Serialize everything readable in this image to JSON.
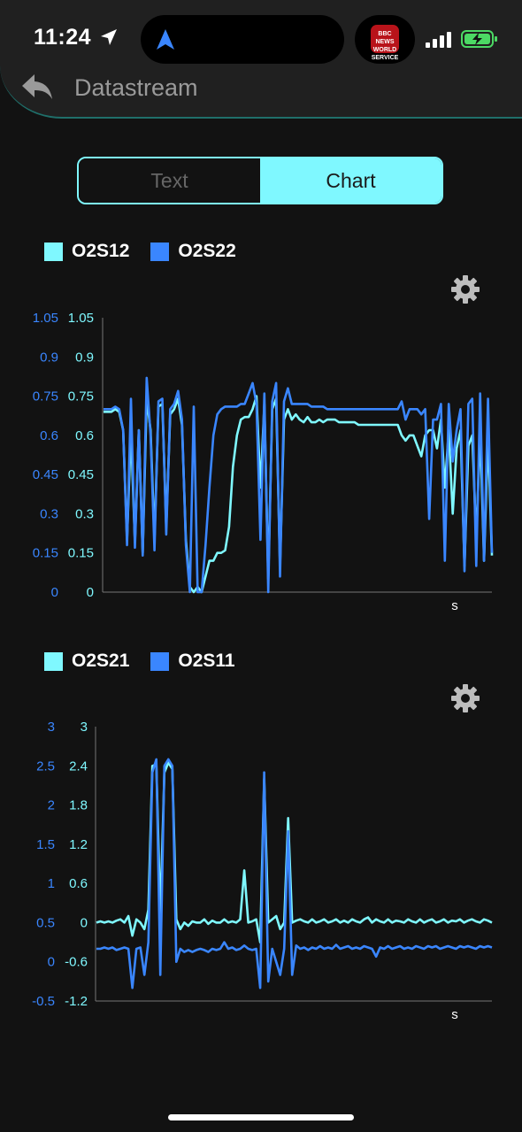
{
  "status_bar": {
    "time": "11:24",
    "news_app": "BBC NEWS WORLD SERVICE"
  },
  "header": {
    "title": "Datastream"
  },
  "tabs": [
    {
      "label": "Text",
      "active": false
    },
    {
      "label": "Chart",
      "active": true
    }
  ],
  "colors": {
    "cyan": "#7ff8ff",
    "blue": "#3a86ff",
    "background": "#121212"
  },
  "icons": [
    "back-arrow-icon",
    "gear-icon",
    "location-arrow-icon"
  ],
  "chart_data": [
    {
      "type": "line",
      "legend": [
        "O2S12",
        "O2S22"
      ],
      "left_axis_ticks": [
        "1.05",
        "0.9",
        "0.75",
        "0.6",
        "0.45",
        "0.3",
        "0.15",
        "0"
      ],
      "right_axis_ticks": [
        "1.05",
        "0.9",
        "0.75",
        "0.6",
        "0.45",
        "0.3",
        "0.15",
        "0"
      ],
      "x_unit": "s",
      "ylim": [
        0,
        1.05
      ],
      "series": [
        {
          "name": "O2S12",
          "color": "#7ff8ff",
          "values": [
            0.69,
            0.69,
            0.69,
            0.7,
            0.69,
            0.62,
            0.2,
            0.62,
            0.19,
            0.62,
            0.15,
            0.74,
            0.62,
            0.2,
            0.71,
            0.72,
            0.25,
            0.68,
            0.7,
            0.74,
            0.64,
            0.2,
            0.02,
            0.0,
            0.02,
            0.0,
            0.06,
            0.12,
            0.12,
            0.15,
            0.15,
            0.16,
            0.25,
            0.48,
            0.6,
            0.66,
            0.67,
            0.67,
            0.7,
            0.75,
            0.4,
            0.72,
            0.05,
            0.7,
            0.74,
            0.1,
            0.66,
            0.7,
            0.66,
            0.68,
            0.66,
            0.65,
            0.67,
            0.65,
            0.65,
            0.66,
            0.65,
            0.66,
            0.66,
            0.66,
            0.65,
            0.65,
            0.65,
            0.65,
            0.65,
            0.64,
            0.64,
            0.64,
            0.64,
            0.64,
            0.64,
            0.64,
            0.64,
            0.64,
            0.64,
            0.64,
            0.6,
            0.58,
            0.6,
            0.6,
            0.56,
            0.52,
            0.6,
            0.62,
            0.62,
            0.55,
            0.66,
            0.4,
            0.62,
            0.3,
            0.55,
            0.62,
            0.1,
            0.56,
            0.6,
            0.2,
            0.62,
            0.12,
            0.6,
            0.14
          ]
        },
        {
          "name": "O2S22",
          "color": "#3a86ff",
          "values": [
            0.7,
            0.7,
            0.7,
            0.71,
            0.7,
            0.62,
            0.18,
            0.74,
            0.17,
            0.62,
            0.14,
            0.82,
            0.6,
            0.16,
            0.73,
            0.74,
            0.22,
            0.7,
            0.72,
            0.77,
            0.66,
            0.18,
            0.0,
            0.71,
            0.0,
            0.0,
            0.18,
            0.4,
            0.6,
            0.68,
            0.7,
            0.71,
            0.71,
            0.71,
            0.71,
            0.72,
            0.72,
            0.76,
            0.8,
            0.72,
            0.2,
            0.76,
            0.0,
            0.73,
            0.8,
            0.06,
            0.73,
            0.78,
            0.72,
            0.72,
            0.72,
            0.72,
            0.72,
            0.71,
            0.71,
            0.71,
            0.71,
            0.7,
            0.7,
            0.7,
            0.7,
            0.7,
            0.7,
            0.7,
            0.7,
            0.7,
            0.7,
            0.7,
            0.7,
            0.7,
            0.7,
            0.7,
            0.7,
            0.7,
            0.7,
            0.7,
            0.73,
            0.66,
            0.7,
            0.7,
            0.7,
            0.68,
            0.7,
            0.28,
            0.66,
            0.66,
            0.72,
            0.12,
            0.72,
            0.5,
            0.62,
            0.7,
            0.08,
            0.72,
            0.74,
            0.1,
            0.76,
            0.12,
            0.74,
            0.15
          ]
        }
      ]
    },
    {
      "type": "line",
      "legend": [
        "O2S21",
        "O2S11"
      ],
      "left_axis_ticks": [
        "3",
        "2.5",
        "2",
        "1.5",
        "1",
        "0.5",
        "0",
        "-0.5"
      ],
      "right_axis_ticks": [
        "3",
        "2.4",
        "1.8",
        "1.2",
        "0.6",
        "0",
        "-0.6",
        "-1.2"
      ],
      "x_unit": "s",
      "ylim": [
        -1.2,
        3
      ],
      "series": [
        {
          "name": "O2S21",
          "color": "#7ff8ff",
          "values": [
            0.0,
            0.02,
            0.0,
            0.02,
            0.0,
            0.03,
            0.05,
            0.0,
            0.1,
            -0.2,
            0.05,
            0.0,
            -0.1,
            0.2,
            2.4,
            2.42,
            0.1,
            2.3,
            2.45,
            2.35,
            0.05,
            -0.1,
            0.0,
            -0.05,
            0.02,
            0.0,
            0.0,
            0.05,
            -0.02,
            0.03,
            0.0,
            0.0,
            0.05,
            0.0,
            0.02,
            0.0,
            0.05,
            0.8,
            0.0,
            0.02,
            0.05,
            -0.3,
            2.2,
            0.0,
            0.05,
            0.1,
            -0.1,
            0.0,
            1.6,
            0.0,
            0.03,
            0.05,
            0.02,
            0.0,
            0.05,
            0.0,
            0.02,
            0.05,
            0.0,
            0.02,
            0.05,
            0.0,
            0.03,
            0.0,
            0.05,
            0.02,
            0.0,
            0.05,
            0.08,
            0.0,
            0.05,
            0.02,
            0.0,
            0.05,
            0.0,
            0.03,
            0.02,
            0.0,
            0.05,
            0.02,
            0.0,
            0.05,
            0.0,
            0.03,
            0.05,
            0.0,
            0.02,
            0.05,
            0.0,
            0.03,
            0.02,
            0.05,
            0.0,
            0.03,
            0.05,
            0.02,
            0.0,
            0.05,
            0.03,
            0.0
          ]
        },
        {
          "name": "O2S11",
          "color": "#3a86ff",
          "values": [
            -0.4,
            -0.4,
            -0.38,
            -0.4,
            -0.38,
            -0.42,
            -0.4,
            -0.38,
            -0.4,
            -1.0,
            -0.4,
            -0.38,
            -0.8,
            -0.3,
            2.3,
            2.5,
            -0.8,
            2.4,
            2.5,
            2.4,
            -0.6,
            -0.4,
            -0.45,
            -0.42,
            -0.45,
            -0.42,
            -0.4,
            -0.42,
            -0.45,
            -0.4,
            -0.42,
            -0.4,
            -0.3,
            -0.4,
            -0.38,
            -0.42,
            -0.4,
            -0.35,
            -0.4,
            -0.42,
            -0.4,
            -1.0,
            2.3,
            -0.9,
            -0.4,
            -0.6,
            -0.8,
            -0.4,
            1.4,
            -0.8,
            -0.35,
            -0.4,
            -0.38,
            -0.42,
            -0.38,
            -0.4,
            -0.36,
            -0.4,
            -0.38,
            -0.4,
            -0.34,
            -0.4,
            -0.38,
            -0.36,
            -0.4,
            -0.38,
            -0.4,
            -0.36,
            -0.38,
            -0.4,
            -0.52,
            -0.38,
            -0.4,
            -0.36,
            -0.4,
            -0.38,
            -0.36,
            -0.4,
            -0.38,
            -0.4,
            -0.36,
            -0.38,
            -0.4,
            -0.36,
            -0.38,
            -0.36,
            -0.4,
            -0.38,
            -0.36,
            -0.38,
            -0.4,
            -0.36,
            -0.38,
            -0.36,
            -0.38,
            -0.4,
            -0.36,
            -0.38,
            -0.36,
            -0.38
          ]
        }
      ]
    }
  ]
}
